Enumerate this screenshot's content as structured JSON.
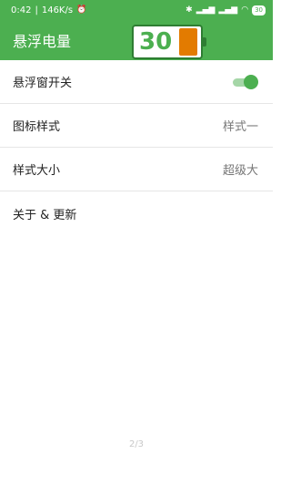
{
  "status_bar": {
    "time": "0:42",
    "net_speed": "146K/s",
    "battery": "30"
  },
  "app_bar": {
    "title": "悬浮电量",
    "widget_level": "30",
    "widget_fill_color": "#e37b00",
    "accent": "#4caf50"
  },
  "settings": [
    {
      "label": "悬浮窗开关",
      "type": "toggle",
      "on": true
    },
    {
      "label": "图标样式",
      "value": "样式一"
    },
    {
      "label": "样式大小",
      "value": "超级大"
    },
    {
      "label": "关于 & 更新"
    }
  ],
  "page_indicator": "2/3"
}
